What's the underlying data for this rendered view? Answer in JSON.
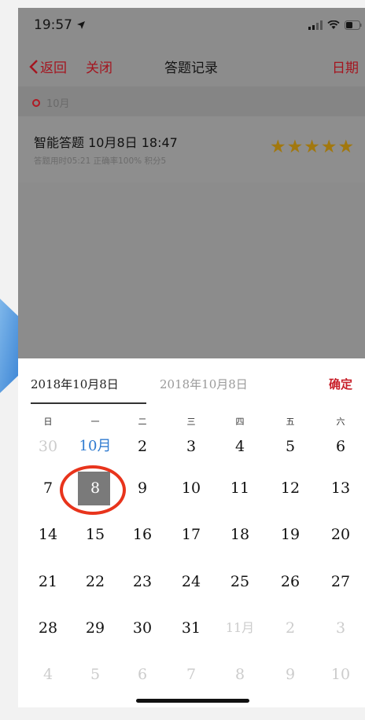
{
  "status_bar": {
    "time": "19:57"
  },
  "nav": {
    "back_label": "返回",
    "close_label": "关闭",
    "title": "答题记录",
    "date_label": "日期"
  },
  "section": {
    "month_label": "10月"
  },
  "record": {
    "title": "智能答题 10月8日 18:47",
    "subtitle": "答题用时05:21 正确率100% 积分5",
    "stars": 5,
    "star_color": "#a2780e"
  },
  "picker": {
    "range_start": "2018年10月8日",
    "range_end": "2018年10月8日",
    "confirm_label": "确定",
    "weekdays": [
      "日",
      "一",
      "二",
      "三",
      "四",
      "五",
      "六"
    ],
    "rows": [
      [
        "30",
        "10月",
        "2",
        "3",
        "4",
        "5",
        "6"
      ],
      [
        "7",
        "8",
        "9",
        "10",
        "11",
        "12",
        "13"
      ],
      [
        "14",
        "15",
        "16",
        "17",
        "18",
        "19",
        "20"
      ],
      [
        "21",
        "22",
        "23",
        "24",
        "25",
        "26",
        "27"
      ],
      [
        "28",
        "29",
        "30",
        "31",
        "11月",
        "2",
        "3"
      ],
      [
        "4",
        "5",
        "6",
        "7",
        "8",
        "9",
        "10"
      ]
    ],
    "selected_day": "8",
    "accent_color": "#c8202a",
    "month_marker_color": "#2f7bd0"
  }
}
